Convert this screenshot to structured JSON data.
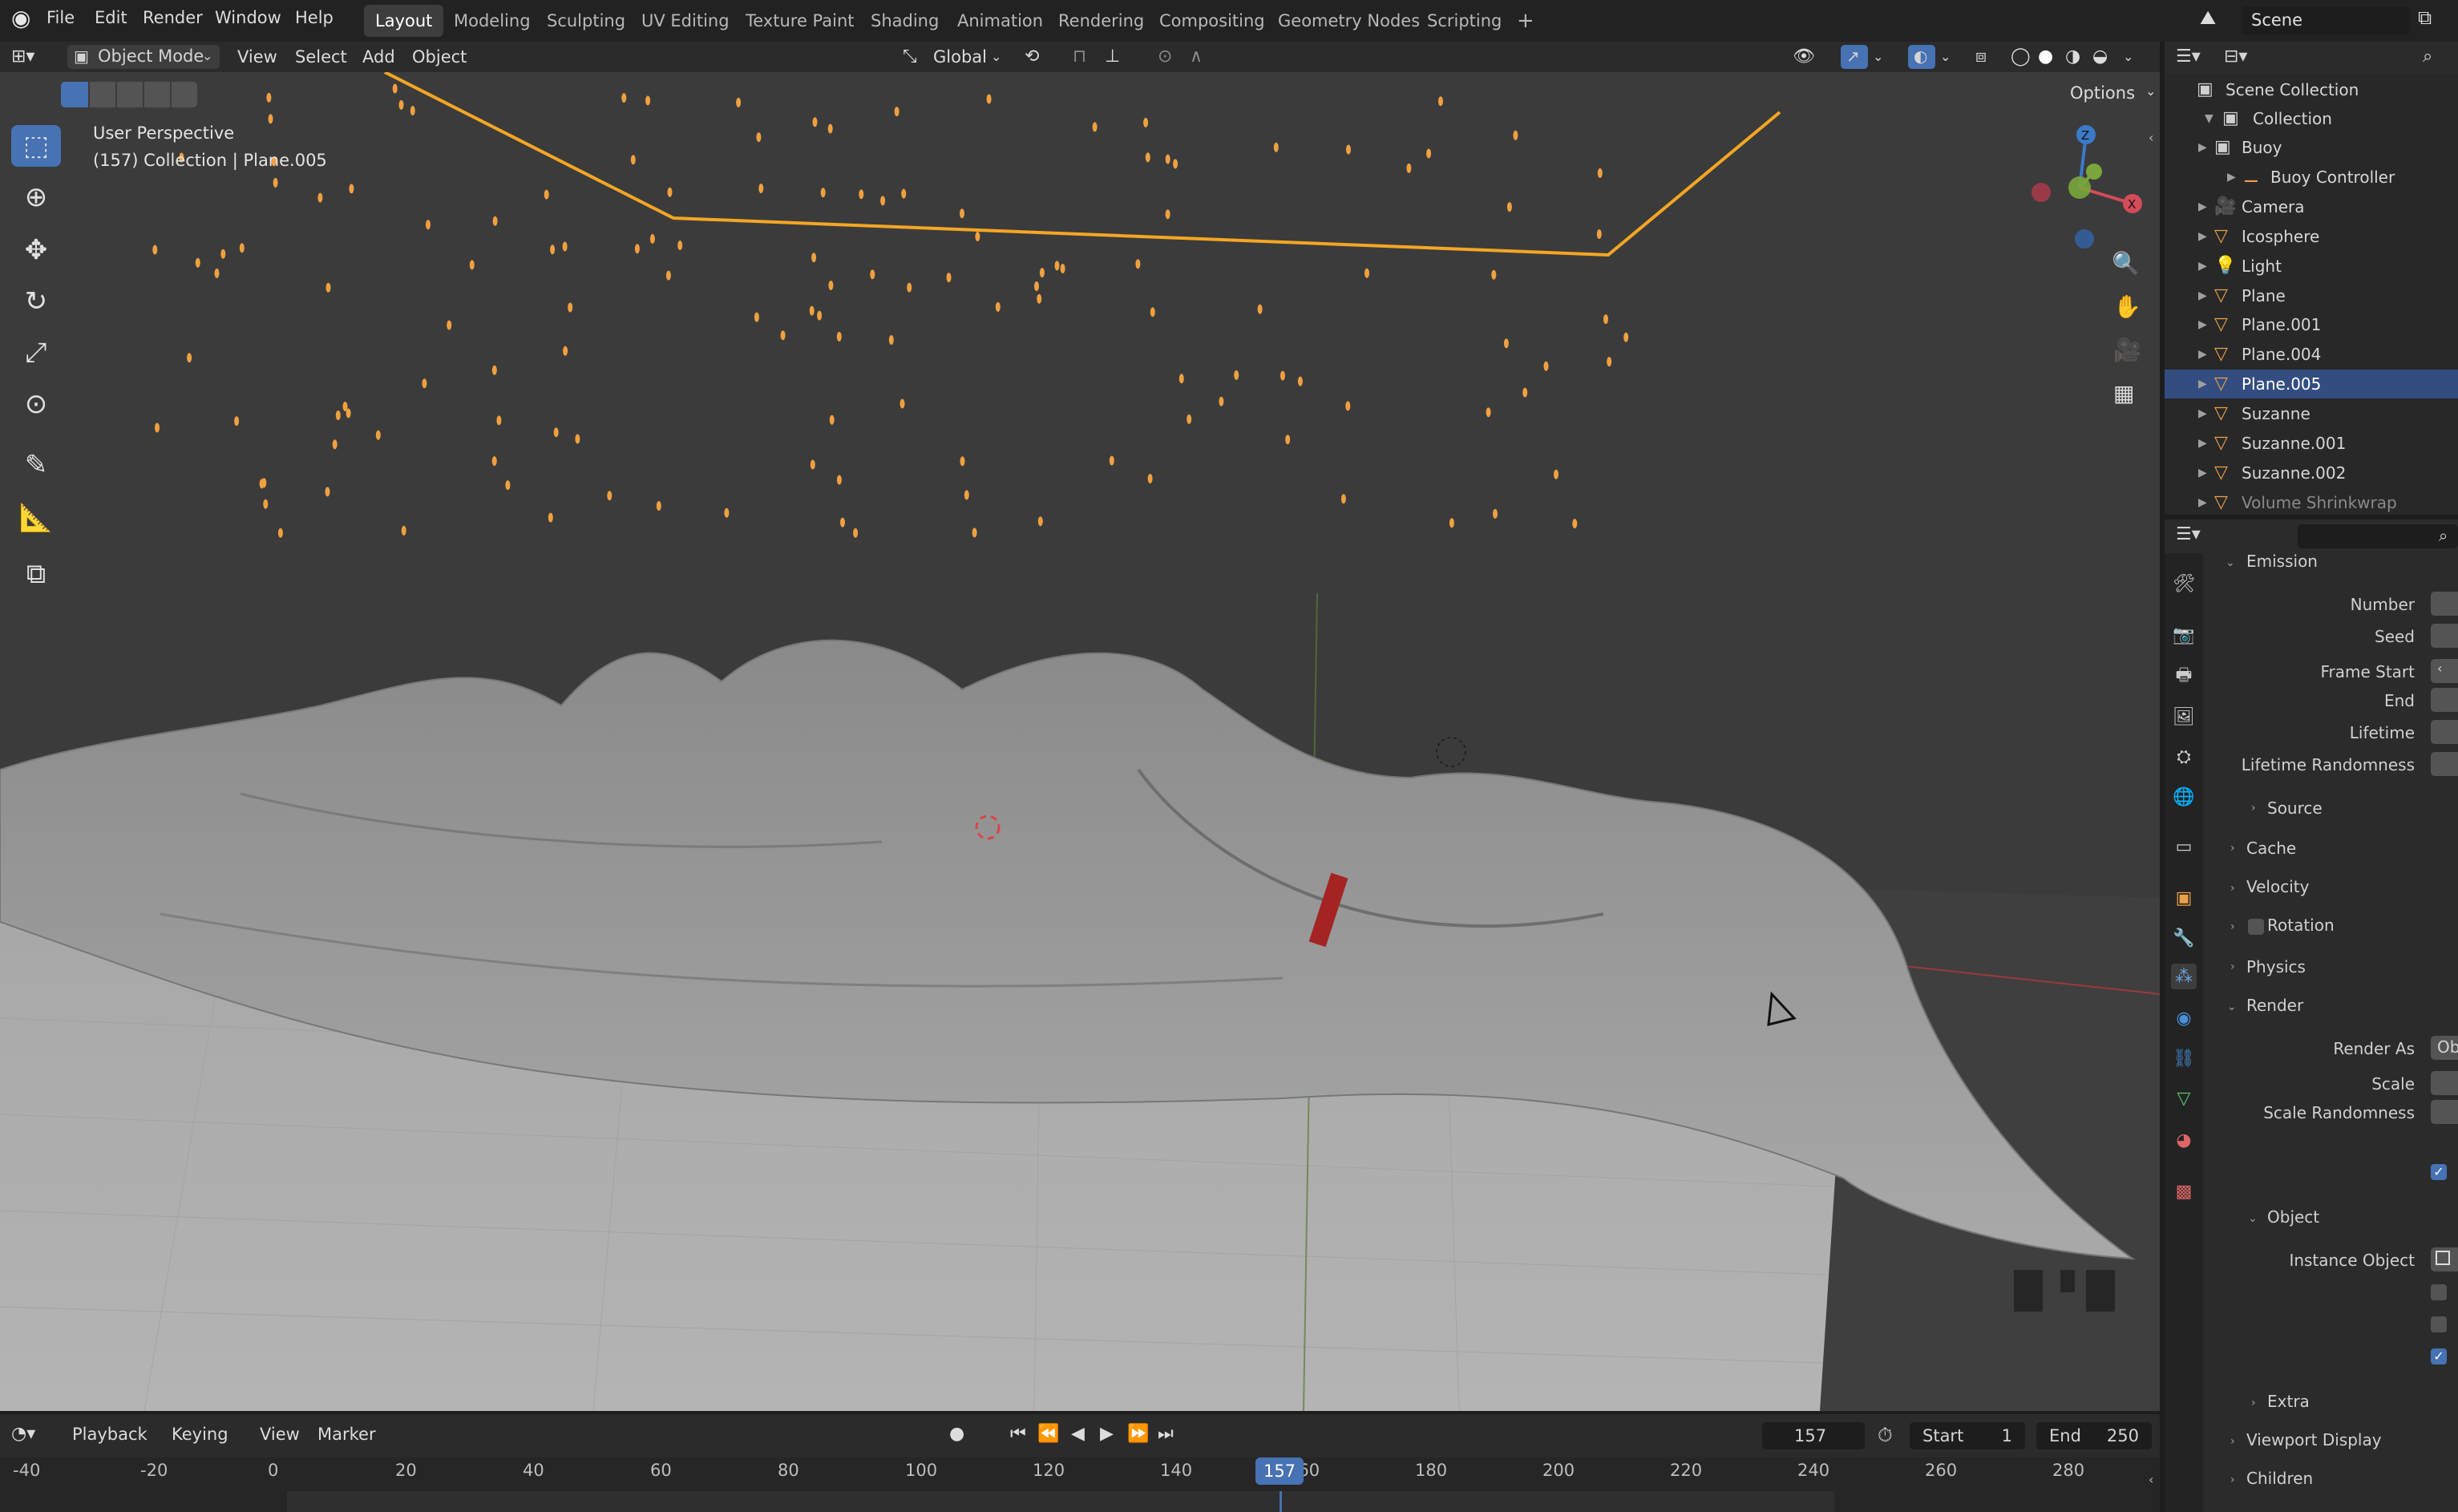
{
  "menubar": {
    "menus": [
      "File",
      "Edit",
      "Render",
      "Window",
      "Help"
    ],
    "workspaces": [
      "Layout",
      "Modeling",
      "Sculpting",
      "UV Editing",
      "Texture Paint",
      "Shading",
      "Animation",
      "Rendering",
      "Compositing",
      "Geometry Nodes",
      "Scripting"
    ],
    "active_workspace": "Layout",
    "add_tab": "+",
    "scene_name": "Scene"
  },
  "viewport_header": {
    "mode": "Object Mode",
    "menus": [
      "View",
      "Select",
      "Add",
      "Object"
    ],
    "transform_orientation": "Global",
    "options": "Options"
  },
  "viewport": {
    "perspective": "User Perspective",
    "context": "(157) Collection | Plane.005",
    "accent_color": "#f0a040",
    "selection_color": "#f5a623"
  },
  "outliner": {
    "root": "Scene Collection",
    "collection": "Collection",
    "items": [
      {
        "label": "Buoy",
        "icon": "collection-icon",
        "level": 2,
        "selected": false
      },
      {
        "label": "Buoy Controller",
        "icon": "armature-icon",
        "level": 3,
        "selected": false
      },
      {
        "label": "Camera",
        "icon": "camera-icon",
        "level": 2,
        "selected": false
      },
      {
        "label": "Icosphere",
        "icon": "mesh-icon",
        "level": 2,
        "selected": false
      },
      {
        "label": "Light",
        "icon": "light-icon",
        "level": 2,
        "selected": false
      },
      {
        "label": "Plane",
        "icon": "mesh-icon",
        "level": 2,
        "selected": false
      },
      {
        "label": "Plane.001",
        "icon": "mesh-icon",
        "level": 2,
        "selected": false
      },
      {
        "label": "Plane.004",
        "icon": "mesh-icon",
        "level": 2,
        "selected": false
      },
      {
        "label": "Plane.005",
        "icon": "mesh-icon",
        "level": 2,
        "selected": true
      },
      {
        "label": "Suzanne",
        "icon": "mesh-icon",
        "level": 2,
        "selected": false
      },
      {
        "label": "Suzanne.001",
        "icon": "mesh-icon",
        "level": 2,
        "selected": false
      },
      {
        "label": "Suzanne.002",
        "icon": "mesh-icon",
        "level": 2,
        "selected": false
      },
      {
        "label": "Volume Shrinkwrap",
        "icon": "mesh-icon",
        "level": 2,
        "selected": false
      }
    ]
  },
  "properties": {
    "emission_panel": "Emission",
    "number": "Number",
    "seed": "Seed",
    "frame_start": "Frame Start",
    "end": "End",
    "lifetime": "Lifetime",
    "lifetime_randomness": "Lifetime Randomness",
    "source": "Source",
    "cache": "Cache",
    "velocity": "Velocity",
    "rotation": "Rotation",
    "physics": "Physics",
    "render_panel": "Render",
    "render_as": "Render As",
    "render_as_value": "Ob",
    "scale": "Scale",
    "scale_randomness": "Scale Randomness",
    "object_panel": "Object",
    "instance_object": "Instance Object",
    "extra": "Extra",
    "viewport_display": "Viewport Display",
    "children": "Children"
  },
  "timeline": {
    "menus": [
      "Playback",
      "Keying",
      "View",
      "Marker"
    ],
    "current_frame": "157",
    "start_label": "Start",
    "start_value": "1",
    "end_label": "End",
    "end_value": "250",
    "ruler_ticks": [
      "-40",
      "-20",
      "0",
      "20",
      "40",
      "60",
      "80",
      "100",
      "120",
      "140",
      "160",
      "180",
      "200",
      "220",
      "240",
      "260",
      "280"
    ],
    "playhead_label": "157"
  }
}
